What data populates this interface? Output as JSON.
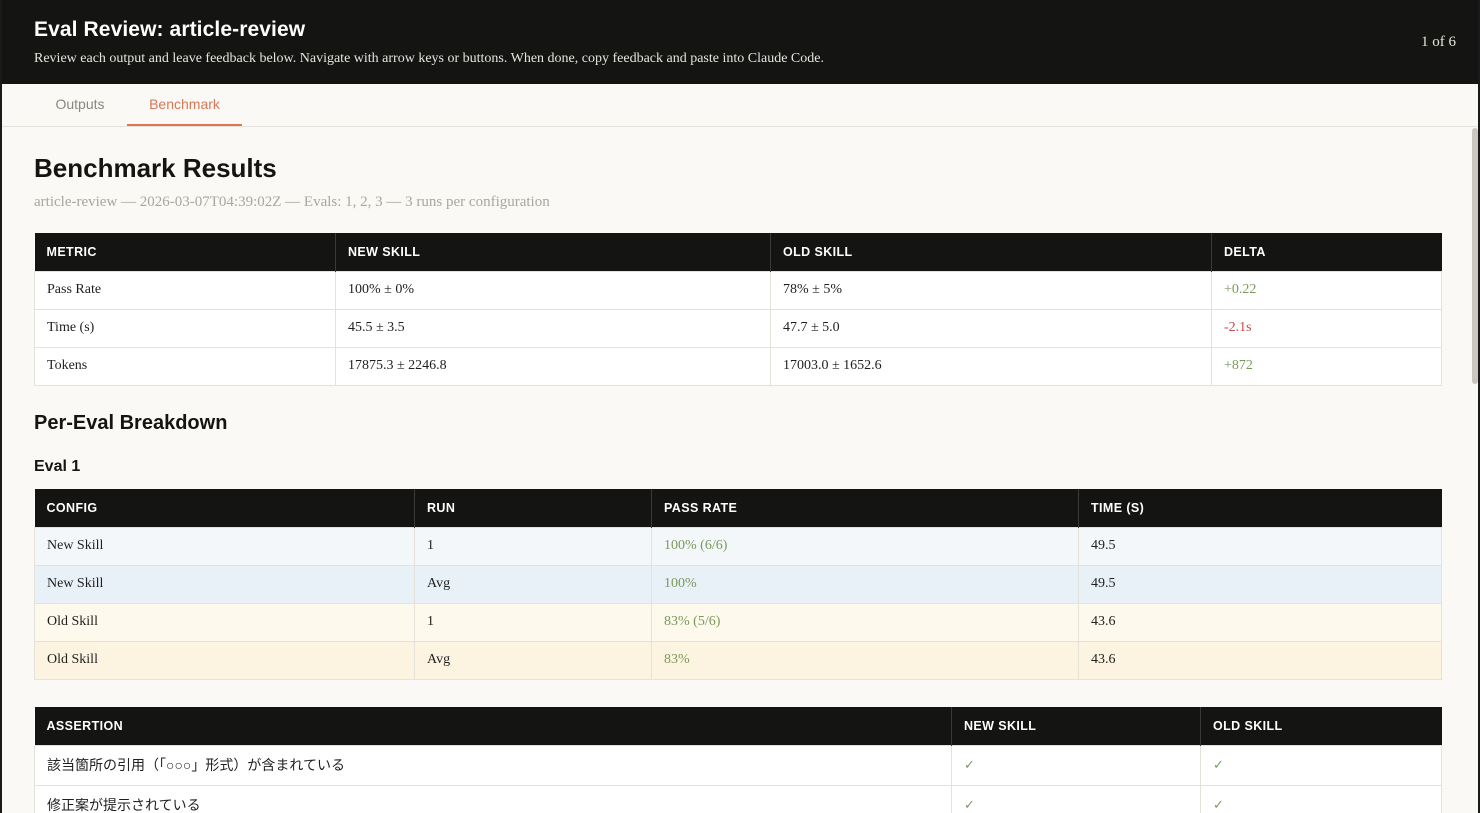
{
  "header": {
    "title": "Eval Review: article-review",
    "subtitle": "Review each output and leave feedback below. Navigate with arrow keys or buttons. When done, copy feedback and paste into Claude Code.",
    "counter": "1 of 6"
  },
  "tabs": [
    {
      "label": "Outputs",
      "active": false
    },
    {
      "label": "Benchmark",
      "active": true
    }
  ],
  "benchmark": {
    "title": "Benchmark Results",
    "meta_skill": "article-review",
    "meta_rest": " — 2026-03-07T04:39:02Z — Evals: 1, 2, 3 — 3 runs per configuration",
    "summary": {
      "headers": [
        "METRIC",
        "NEW SKILL",
        "OLD SKILL",
        "DELTA"
      ],
      "rows": [
        {
          "metric": "Pass Rate",
          "new": "100% ± 0%",
          "old": "78% ± 5%",
          "delta": "+0.22",
          "delta_sign": "pos"
        },
        {
          "metric": "Time (s)",
          "new": "45.5 ± 3.5",
          "old": "47.7 ± 5.0",
          "delta": "-2.1s",
          "delta_sign": "neg"
        },
        {
          "metric": "Tokens",
          "new": "17875.3 ± 2246.8",
          "old": "17003.0 ± 1652.6",
          "delta": "+872",
          "delta_sign": "pos"
        }
      ]
    },
    "breakdown_title": "Per-Eval Breakdown",
    "eval1": {
      "title": "Eval 1",
      "headers": [
        "CONFIG",
        "RUN",
        "PASS RATE",
        "TIME (S)"
      ],
      "rows": [
        {
          "config": "New Skill",
          "run": "1",
          "pass_rate": "100% (6/6)",
          "time": "49.5"
        },
        {
          "config": "New Skill",
          "run": "Avg",
          "pass_rate": "100%",
          "time": "49.5"
        },
        {
          "config": "Old Skill",
          "run": "1",
          "pass_rate": "83% (5/6)",
          "time": "43.6"
        },
        {
          "config": "Old Skill",
          "run": "Avg",
          "pass_rate": "83%",
          "time": "43.6"
        }
      ]
    },
    "assertions": {
      "headers": [
        "ASSERTION",
        "NEW SKILL",
        "OLD SKILL"
      ],
      "rows": [
        {
          "text": "該当箇所の引用（「○○○」形式）が含まれている",
          "new": "✓",
          "old": "✓"
        },
        {
          "text": "修正案が提示されている",
          "new": "✓",
          "old": "✓"
        }
      ]
    }
  },
  "colors": {
    "accent": "#d97757",
    "header_bg": "#141413",
    "positive": "#7a9a5c",
    "negative": "#c94a4a"
  }
}
